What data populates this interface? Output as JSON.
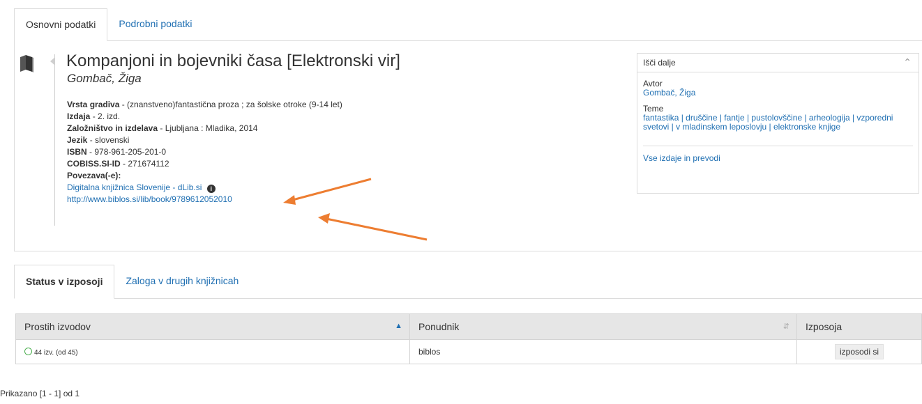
{
  "tabs_top": [
    "Osnovni podatki",
    "Podrobni podatki"
  ],
  "record": {
    "title": "Kompanjoni in bojevniki časa [Elektronski vir]",
    "author": "Gombač, Žiga",
    "fields": [
      {
        "label": "Vrsta gradiva",
        "value": "(znanstveno)fantastična proza ; za šolske otroke (9-14 let)"
      },
      {
        "label": "Izdaja",
        "value": "2. izd."
      },
      {
        "label": "Založništvo in izdelava",
        "value": "Ljubljana : Mladika, 2014"
      },
      {
        "label": "Jezik",
        "value": "slovenski"
      },
      {
        "label": "ISBN",
        "value": "978-961-205-201-0"
      },
      {
        "label": "COBISS.SI-ID",
        "value": "271674112"
      }
    ],
    "links_label": "Povezava(-e):",
    "links": [
      "Digitalna knjižnica Slovenije - dLib.si",
      "http://www.biblos.si/lib/book/9789612052010"
    ],
    "info_icon": "i"
  },
  "sidebox": {
    "header": "Išči dalje",
    "author_label": "Avtor",
    "author_value": "Gombač, Žiga",
    "topics_label": "Teme",
    "topics": "fantastika | druščine | fantje | pustolovščine | arheologija | vzporedni svetovi | v mladinskem leposlovju | elektronske knjige",
    "all_editions": "Vse izdaje in prevodi"
  },
  "tabs_bottom": [
    "Status v izposoji",
    "Zaloga v drugih knjižnicah"
  ],
  "table": {
    "headers": [
      "Prostih izvodov",
      "Ponudnik",
      "Izposoja"
    ],
    "row": {
      "copies": "44 izv. (od 45)",
      "provider": "biblos",
      "action": "izposodi si"
    }
  },
  "footer": "Prikazano [1 - 1] od 1",
  "colors": {
    "link": "#1f6fb2",
    "arrow": "#ed7d31",
    "available": "#4caf50"
  }
}
